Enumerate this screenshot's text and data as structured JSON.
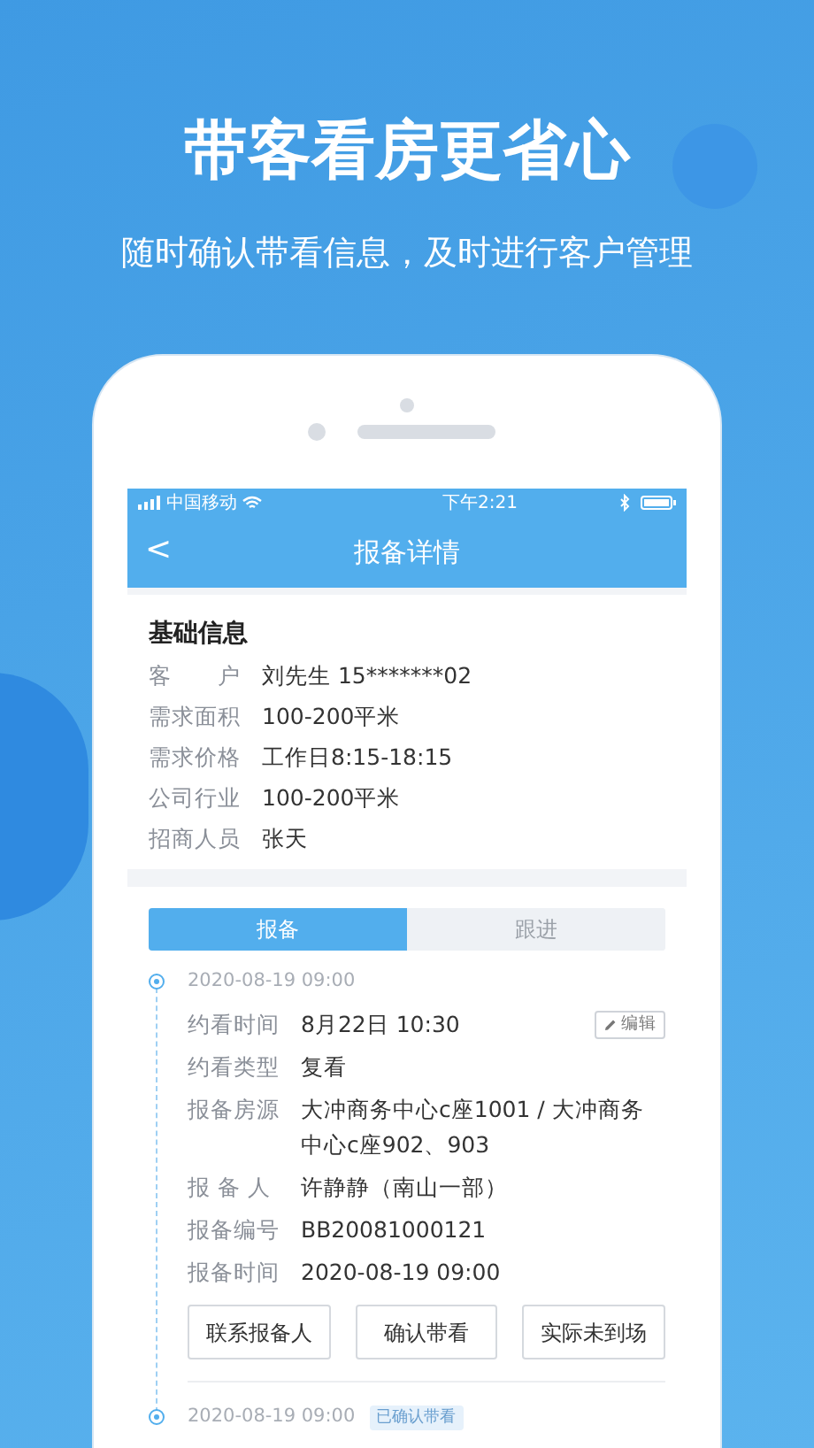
{
  "headline": "带客看房更省心",
  "subtitle": "随时确认带看信息，及时进行客户管理",
  "status_bar": {
    "carrier": "中国移动",
    "time": "下午2:21"
  },
  "nav": {
    "back": "<",
    "title": "报备详情"
  },
  "basic_info": {
    "title": "基础信息",
    "rows": [
      {
        "label": "客　　户",
        "value": "刘先生 15*******02"
      },
      {
        "label": "需求面积",
        "value": "100-200平米"
      },
      {
        "label": "需求价格",
        "value": "工作日8:15-18:15"
      },
      {
        "label": "公司行业",
        "value": "100-200平米"
      },
      {
        "label": "招商人员",
        "value": "张天"
      }
    ]
  },
  "tabs": [
    {
      "label": "报备",
      "selected": true
    },
    {
      "label": "跟进",
      "selected": false
    }
  ],
  "timeline": [
    {
      "time": "2020-08-19 09:00",
      "edit": "编辑",
      "rows": [
        {
          "label": "约看时间",
          "value": "8月22日 10:30"
        },
        {
          "label": "约看类型",
          "value": "复看"
        },
        {
          "label": "报备房源",
          "value": "大冲商务中心c座1001 / 大冲商务中心c座902、903"
        },
        {
          "label": "报 备 人",
          "value": "许静静（南山一部）"
        },
        {
          "label": "报备编号",
          "value": "BB20081000121"
        },
        {
          "label": "报备时间",
          "value": "2020-08-19 09:00"
        }
      ],
      "actions": [
        "联系报备人",
        "确认带看",
        "实际未到场"
      ]
    },
    {
      "time": "2020-08-19 09:00",
      "badge": "已确认带看"
    }
  ]
}
